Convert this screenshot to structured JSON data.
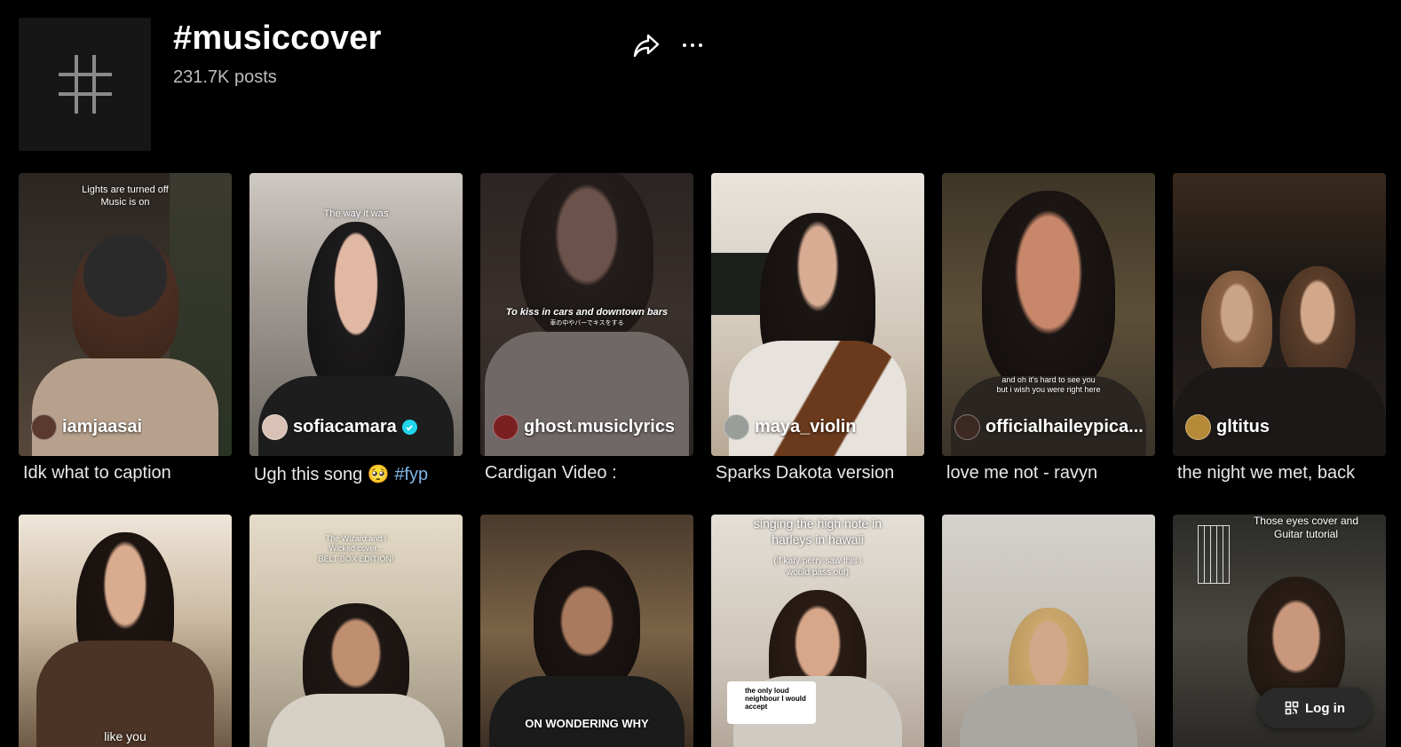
{
  "header": {
    "title": "#musiccover",
    "posts": "231.7K posts",
    "hashtag_icon": "hashtag-icon",
    "share_icon": "share-arrow-icon",
    "more_icon": "more-dots-icon"
  },
  "row1": [
    {
      "overlay": "Lights are turned off\nMusic is on",
      "user": "iamjaasai",
      "caption": "Idk what to caption",
      "verified": false
    },
    {
      "overlay": "The way it was",
      "user": "sofiacamara",
      "caption": "Ugh this song 🥺 ",
      "tag": "#fyp",
      "verified": true
    },
    {
      "overlay": "To kiss in cars and downtown bars",
      "overlay_sub": "車の中やバーでキスをする",
      "user": "ghost.musiclyrics",
      "caption": "Cardigan Video :",
      "verified": false
    },
    {
      "overlay": "",
      "user": "maya_violin",
      "caption": "Sparks Dakota version",
      "verified": false
    },
    {
      "overlay": "and oh it's hard to see you\nbut i wish you were right here",
      "user": "officialhaileypica...",
      "caption": "love me not - ravyn",
      "verified": false
    },
    {
      "overlay": "",
      "user": "gltitus",
      "caption": "the night we met, back",
      "verified": false
    }
  ],
  "row2": [
    {
      "overlay": "like you"
    },
    {
      "overlay": "The Wizard and I\nWicked cover...\nBELT BOX EDITION!"
    },
    {
      "overlay": "ON WONDERING WHY"
    },
    {
      "overlay": "singing the high note in\nharleys in hawaii",
      "overlay_sub": "(if katy perry saw this i\nwould pass out)",
      "reply": "the only loud\nneighbour I would\naccept"
    },
    {
      "overlay": ""
    },
    {
      "overlay": "Those eyes cover and\nGuitar tutorial"
    }
  ],
  "login": {
    "label": "Log in",
    "icon": "qr-code-icon"
  },
  "colors": {
    "background": "#000000",
    "verified": "#20d5ec",
    "hashtag_link": "#7fb6e6",
    "button": "#2a2a2a"
  }
}
